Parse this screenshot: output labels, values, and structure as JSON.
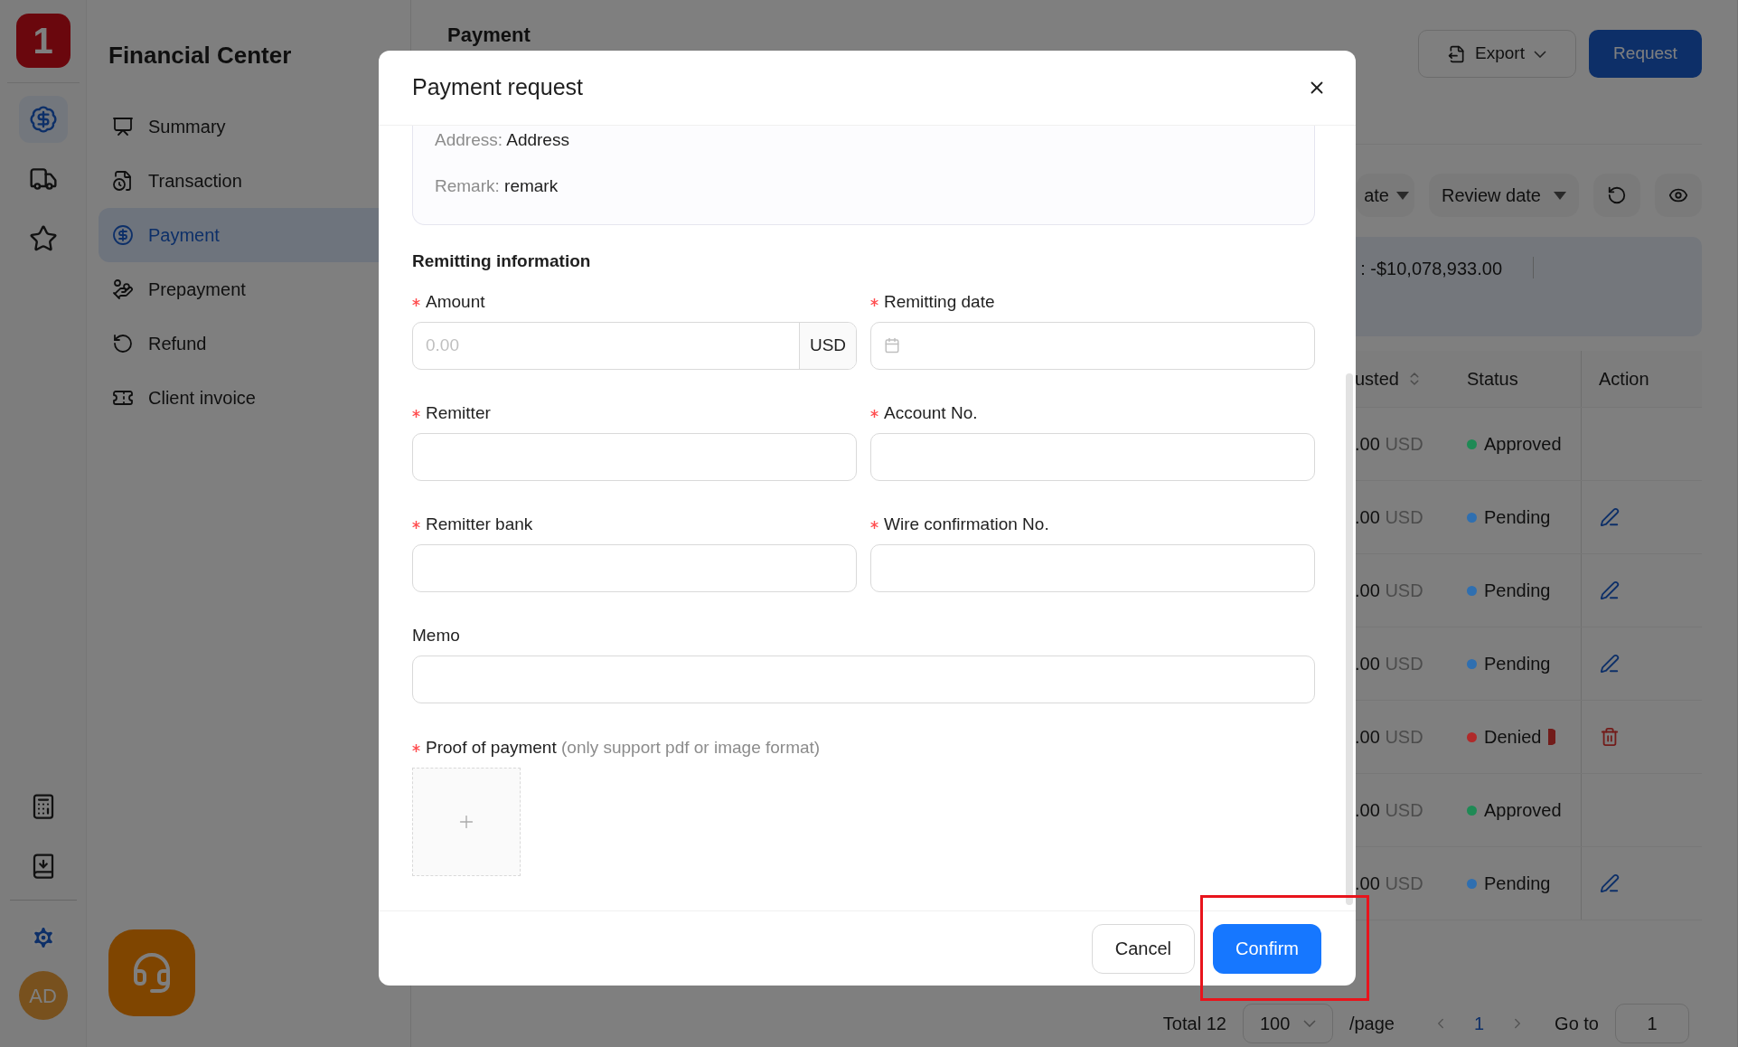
{
  "rail": {
    "logo": "1",
    "items": [
      {
        "selected": true
      },
      {
        "selected": false
      },
      {
        "selected": false
      }
    ],
    "avatar": "AD"
  },
  "nav": {
    "title": "Financial Center",
    "items": [
      {
        "label": "Summary",
        "selected": false
      },
      {
        "label": "Transaction",
        "selected": false
      },
      {
        "label": "Payment",
        "selected": true
      },
      {
        "label": "Prepayment",
        "selected": false
      },
      {
        "label": "Refund",
        "selected": false
      },
      {
        "label": "Client invoice",
        "selected": false
      }
    ]
  },
  "page": {
    "title": "Payment",
    "export_button": "Export",
    "request_button": "Request"
  },
  "filters": [
    {
      "label": "ate"
    },
    {
      "label": "Review date"
    }
  ],
  "summary": {
    "total": ": -$10,078,933.00"
  },
  "table": {
    "columns": [
      "usted",
      "Status",
      "Action"
    ],
    "rows": [
      {
        "amount": ".00",
        "currency": "USD",
        "status": "Approved",
        "color": "#1f8a55",
        "kind": "none",
        "alert": false
      },
      {
        "amount": ".00",
        "currency": "USD",
        "status": "Pending",
        "color": "#2f6fb0",
        "kind": "edit",
        "alert": false
      },
      {
        "amount": ".00",
        "currency": "USD",
        "status": "Pending",
        "color": "#2f6fb0",
        "kind": "edit",
        "alert": false
      },
      {
        "amount": ".00",
        "currency": "USD",
        "status": "Pending",
        "color": "#2f6fb0",
        "kind": "edit",
        "alert": false
      },
      {
        "amount": ".00",
        "currency": "USD",
        "status": "Denied",
        "color": "#b02a2a",
        "kind": "delete",
        "alert": true
      },
      {
        "amount": ".00",
        "currency": "USD",
        "status": "Approved",
        "color": "#1f8a55",
        "kind": "none",
        "alert": false
      },
      {
        "amount": ".00",
        "currency": "USD",
        "status": "Pending",
        "color": "#2f6fb0",
        "kind": "edit",
        "alert": false
      }
    ]
  },
  "pagination": {
    "total": "Total 12",
    "page_size": "100",
    "per_page": "/page",
    "pages": [
      {
        "label": "1",
        "selected": true
      }
    ],
    "goto_label": "Go to",
    "goto_value": "1"
  },
  "modal": {
    "title": "Payment request",
    "details": [
      {
        "label": "Address:",
        "value": "Address"
      },
      {
        "label": "Remark:",
        "value": "remark"
      }
    ],
    "section": "Remitting information",
    "fields": [
      {
        "label": "Amount",
        "required": true,
        "kind": "amount",
        "placeholder": "0.00",
        "suffix": "USD",
        "wide": false
      },
      {
        "label": "Remitting date",
        "required": true,
        "kind": "date",
        "wide": false
      },
      {
        "label": "Remitter",
        "required": true,
        "kind": "text",
        "wide": false
      },
      {
        "label": "Account No.",
        "required": true,
        "kind": "text",
        "wide": false
      },
      {
        "label": "Remitter bank",
        "required": true,
        "kind": "text",
        "wide": false
      },
      {
        "label": "Wire confirmation No.",
        "required": true,
        "kind": "text",
        "wide": false
      },
      {
        "label": "Memo",
        "required": false,
        "kind": "text",
        "wide": true
      }
    ],
    "upload": {
      "label": "Proof of payment",
      "hint": "(only support pdf or image format)",
      "required": true
    },
    "buttons": [
      {
        "label": "Cancel",
        "kind": "default"
      },
      {
        "label": "Confirm",
        "kind": "primary"
      }
    ]
  },
  "annotations": [
    {
      "kind": "highlight-frame"
    }
  ]
}
